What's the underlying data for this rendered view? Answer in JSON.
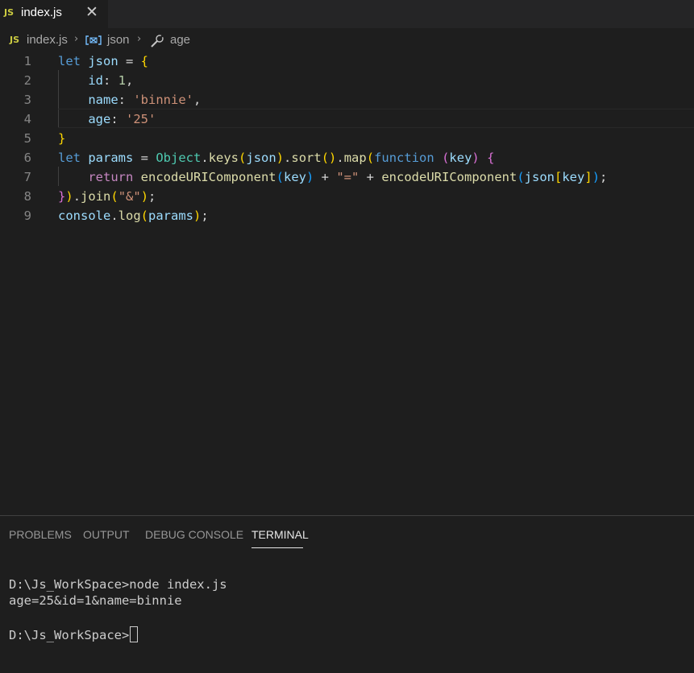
{
  "tab": {
    "badge": "JS",
    "title": "index.js",
    "close": "✕"
  },
  "breadcrumb": {
    "badge": "JS",
    "file": "index.js",
    "symbol": "json",
    "property": "age"
  },
  "editor": {
    "line_numbers": [
      "1",
      "2",
      "3",
      "4",
      "5",
      "6",
      "7",
      "8",
      "9"
    ],
    "lines": [
      [
        [
          "kw",
          "let"
        ],
        [
          "plain",
          " "
        ],
        [
          "var",
          "json"
        ],
        [
          "plain",
          " = "
        ],
        [
          "br1",
          "{"
        ]
      ],
      [
        [
          "plain",
          "    "
        ],
        [
          "var",
          "id"
        ],
        [
          "plain",
          ": "
        ],
        [
          "num",
          "1"
        ],
        [
          "plain",
          ","
        ]
      ],
      [
        [
          "plain",
          "    "
        ],
        [
          "var",
          "name"
        ],
        [
          "plain",
          ": "
        ],
        [
          "str",
          "'binnie'"
        ],
        [
          "plain",
          ","
        ]
      ],
      [
        [
          "plain",
          "    "
        ],
        [
          "var",
          "age"
        ],
        [
          "plain",
          ": "
        ],
        [
          "str",
          "'25'"
        ]
      ],
      [
        [
          "br1",
          "}"
        ]
      ],
      [
        [
          "kw",
          "let"
        ],
        [
          "plain",
          " "
        ],
        [
          "var",
          "params"
        ],
        [
          "plain",
          " = "
        ],
        [
          "cls",
          "Object"
        ],
        [
          "plain",
          "."
        ],
        [
          "fn",
          "keys"
        ],
        [
          "br1",
          "("
        ],
        [
          "var",
          "json"
        ],
        [
          "br1",
          ")"
        ],
        [
          "plain",
          "."
        ],
        [
          "fn",
          "sort"
        ],
        [
          "br1",
          "()"
        ],
        [
          "plain",
          "."
        ],
        [
          "fn",
          "map"
        ],
        [
          "br1",
          "("
        ],
        [
          "kw",
          "function"
        ],
        [
          "plain",
          " "
        ],
        [
          "br2",
          "("
        ],
        [
          "var",
          "key"
        ],
        [
          "br2",
          ")"
        ],
        [
          "plain",
          " "
        ],
        [
          "br2",
          "{"
        ]
      ],
      [
        [
          "plain",
          "    "
        ],
        [
          "ctl",
          "return"
        ],
        [
          "plain",
          " "
        ],
        [
          "fn",
          "encodeURIComponent"
        ],
        [
          "br3",
          "("
        ],
        [
          "var",
          "key"
        ],
        [
          "br3",
          ")"
        ],
        [
          "plain",
          " + "
        ],
        [
          "str",
          "\"=\""
        ],
        [
          "plain",
          " + "
        ],
        [
          "fn",
          "encodeURIComponent"
        ],
        [
          "br3",
          "("
        ],
        [
          "var",
          "json"
        ],
        [
          "br1",
          "["
        ],
        [
          "var",
          "key"
        ],
        [
          "br1",
          "]"
        ],
        [
          "br3",
          ")"
        ],
        [
          "plain",
          ";"
        ]
      ],
      [
        [
          "br2",
          "}"
        ],
        [
          "br1",
          ")"
        ],
        [
          "plain",
          "."
        ],
        [
          "fn",
          "join"
        ],
        [
          "br1",
          "("
        ],
        [
          "str",
          "\"&\""
        ],
        [
          "br1",
          ")"
        ],
        [
          "plain",
          ";"
        ]
      ],
      [
        [
          "var",
          "console"
        ],
        [
          "plain",
          "."
        ],
        [
          "fn",
          "log"
        ],
        [
          "br1",
          "("
        ],
        [
          "var",
          "params"
        ],
        [
          "br1",
          ")"
        ],
        [
          "plain",
          ";"
        ]
      ]
    ]
  },
  "panel": {
    "tabs": [
      "PROBLEMS",
      "OUTPUT",
      "DEBUG CONSOLE",
      "TERMINAL"
    ],
    "active_tab": "TERMINAL",
    "terminal": {
      "command_line": "D:\\Js_WorkSpace>node index.js",
      "output_line": "age=25&id=1&name=binnie",
      "prompt": "D:\\Js_WorkSpace>"
    }
  },
  "colors": {
    "editor_bg": "#1e1e1e",
    "tabbar_bg": "#252526",
    "js_badge": "#cbcb41",
    "keyword": "#569cd6",
    "string": "#ce9178",
    "function": "#dcdcaa"
  },
  "icons": {
    "symbol": "variable-icon",
    "property": "wrench-icon",
    "separator": "chevron-right-icon",
    "close": "close-icon"
  }
}
